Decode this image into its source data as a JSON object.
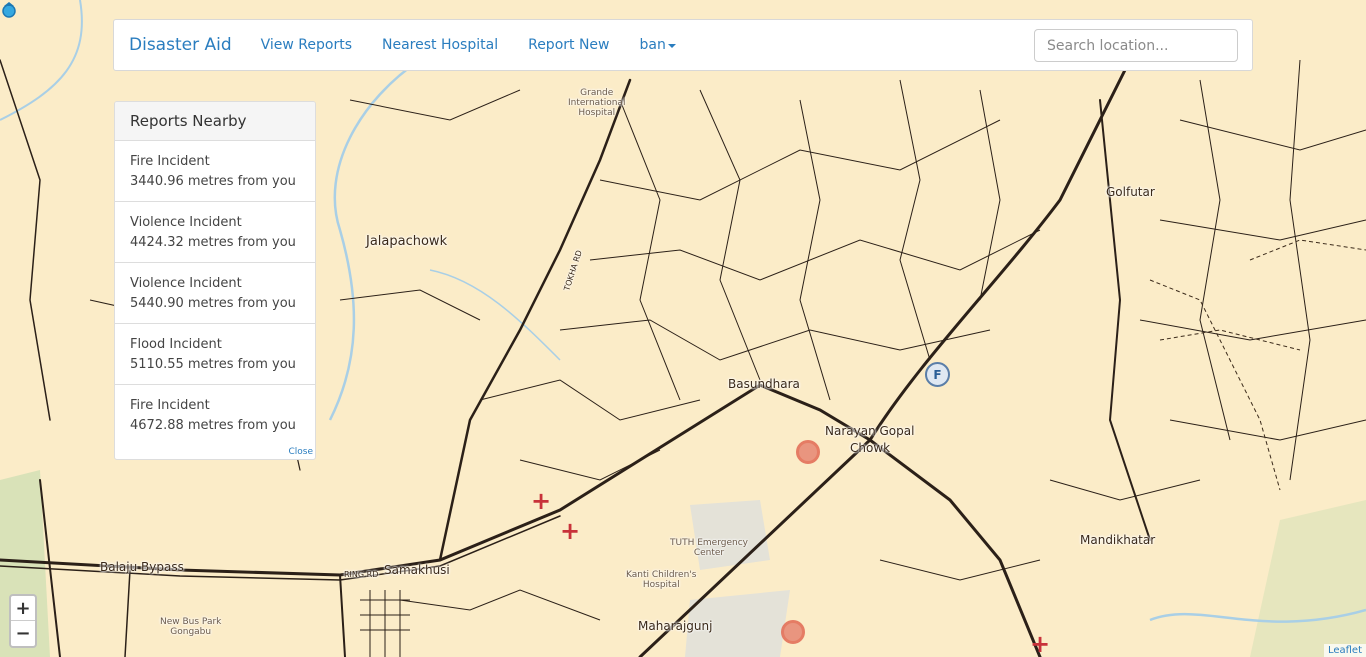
{
  "navbar": {
    "brand": "Disaster Aid",
    "links": [
      "View Reports",
      "Nearest Hospital",
      "Report New"
    ],
    "user_menu": "ban",
    "search_placeholder": "Search location..."
  },
  "reports_panel": {
    "title": "Reports Nearby",
    "items": [
      {
        "type": "Fire Incident",
        "distance": "3440.96 metres from you"
      },
      {
        "type": "Violence Incident",
        "distance": "4424.32 metres from you"
      },
      {
        "type": "Violence Incident",
        "distance": "5440.90 metres from you"
      },
      {
        "type": "Flood Incident",
        "distance": "5110.55 metres from you"
      },
      {
        "type": "Fire Incident",
        "distance": "4672.88 metres from you"
      }
    ],
    "close_label": "Close"
  },
  "map": {
    "labels": {
      "jalapachowk": "Jalapachowk",
      "basundhara": "Basundhara",
      "narayan_gopal": "Narayan Gopal",
      "chowk": "Chowk",
      "golfutar": "Golfutar",
      "mandikhatar": "Mandikhatar",
      "balaju_bypass": "Balaju Bypass",
      "samakhusi": "Samakhusi",
      "maharajgunj": "Maharajgunj",
      "grande": "Grande\nInternational\nHospital",
      "tuth": "TUTH Emergency\nCenter",
      "kanti": "Kanti Children's\nHospital",
      "bus_park": "New Bus Park\nGongabu",
      "ring_rd": "RING RD",
      "tokha_rd": "TOKHA RD"
    },
    "zoom_in": "+",
    "zoom_out": "−",
    "attribution": "Leaflet",
    "fire_station_letter": "F"
  },
  "colors": {
    "map_background": "#fbecc8",
    "link": "#2a7dbf",
    "incident_marker": "#e3705a",
    "hospital_marker": "#c8323a"
  }
}
